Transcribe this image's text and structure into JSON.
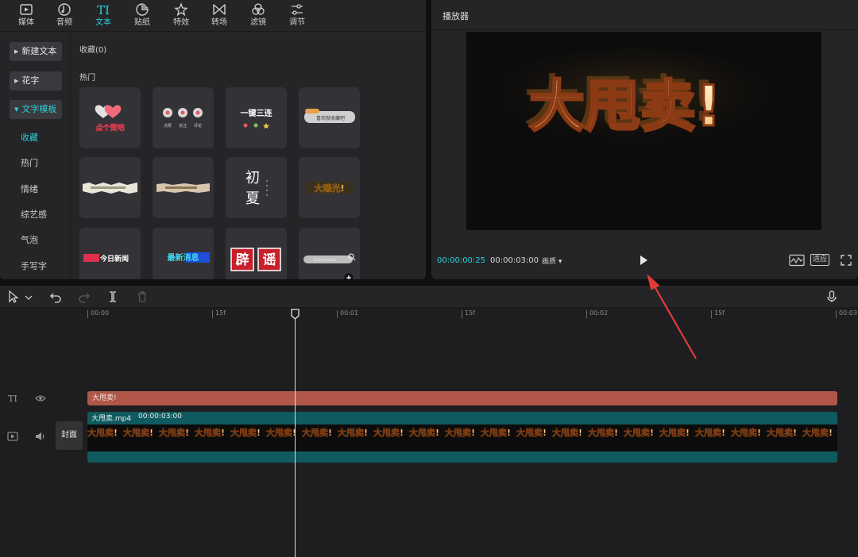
{
  "top_tabs": [
    {
      "label": "媒体",
      "icon": "media-icon"
    },
    {
      "label": "音频",
      "icon": "audio-icon"
    },
    {
      "label": "文本",
      "icon": "text-icon"
    },
    {
      "label": "贴纸",
      "icon": "sticker-icon"
    },
    {
      "label": "特效",
      "icon": "effects-icon"
    },
    {
      "label": "转场",
      "icon": "transition-icon"
    },
    {
      "label": "滤镜",
      "icon": "filter-icon"
    },
    {
      "label": "调节",
      "icon": "adjust-icon"
    }
  ],
  "active_tab": "文本",
  "sidebar": {
    "buttons": [
      {
        "label": "新建文本"
      },
      {
        "label": "花字"
      },
      {
        "label": "文字模板"
      }
    ],
    "sub_items": [
      "收藏",
      "热门",
      "情绪",
      "综艺感",
      "气泡",
      "手写字"
    ],
    "active_sub": "收藏"
  },
  "content": {
    "favorites_label": "收藏(0)",
    "hot_label": "热门",
    "templates": [
      {
        "text": "点个赞吧"
      },
      {
        "text": "点赞 关注 评论",
        "labels": [
          "点赞",
          "关注",
          "评论"
        ]
      },
      {
        "text": "一键三连"
      },
      {
        "text": "喜欢就收藏吧"
      },
      {
        "text": ""
      },
      {
        "text": ""
      },
      {
        "text": "初夏"
      },
      {
        "text": "大曝光!"
      },
      {
        "text": "今日新闻"
      },
      {
        "text": "最新消息"
      },
      {
        "text": "辟谣"
      },
      {
        "text": "Expert store"
      }
    ]
  },
  "player": {
    "title": "播放器",
    "current_time": "00:00:00:25",
    "duration": "00:00:03:00",
    "ratio_label": "画质",
    "fit_label": "适应",
    "video_text": "大甩卖!"
  },
  "timeline": {
    "ruler_labels": [
      "00:00",
      "15f",
      "00:01",
      "15f",
      "00:02",
      "15f",
      "00:03"
    ],
    "text_clip_label": "大甩卖!",
    "video_clip_name": "大甩卖.mp4",
    "video_clip_duration": "00:00:03:00",
    "cover_label": "封面",
    "filmstrip_text": "大甩卖!",
    "text_track_label": "TI",
    "playhead_time": "00:00:00:25"
  },
  "colors": {
    "accent": "#2ad0d8",
    "text_clip": "#b0574a",
    "video_clip": "#0f5a5e",
    "annotation_arrow": "#e23b36"
  }
}
